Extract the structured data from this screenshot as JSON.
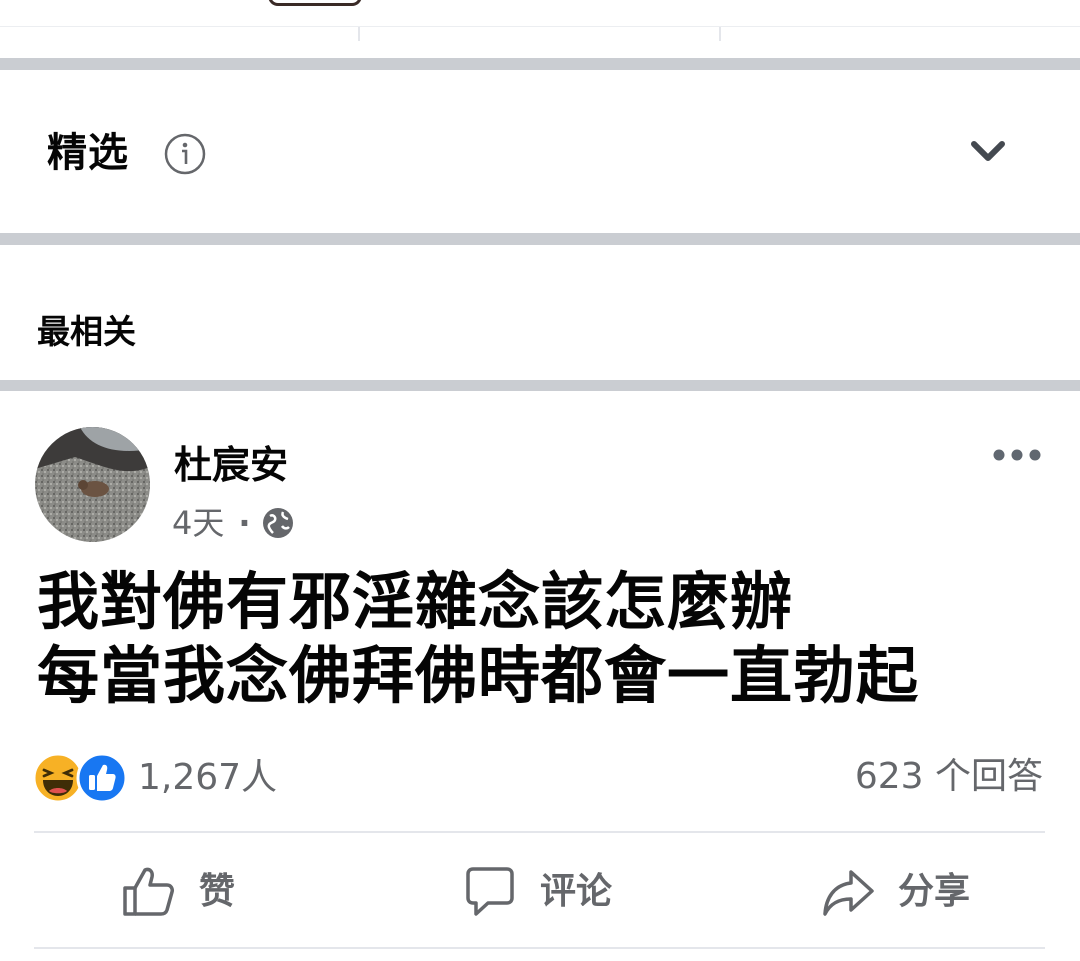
{
  "featured": {
    "title": "精选"
  },
  "sort": {
    "label": "最相关"
  },
  "post": {
    "author": "杜宸安",
    "time": "4天",
    "dot": "·",
    "line1": "我對佛有邪淫雜念該怎麼辦",
    "line2": "每當我念佛拜佛時都會一直勃起",
    "reaction_count": "1,267人",
    "answers": "623 个回答"
  },
  "actions": {
    "like": "赞",
    "comment": "评论",
    "share": "分享"
  },
  "colors": {
    "separator": "#cacdd2",
    "secondary_text": "#65676b",
    "like_blue": "#1877f2",
    "haha_yellow": "#f7b125"
  }
}
